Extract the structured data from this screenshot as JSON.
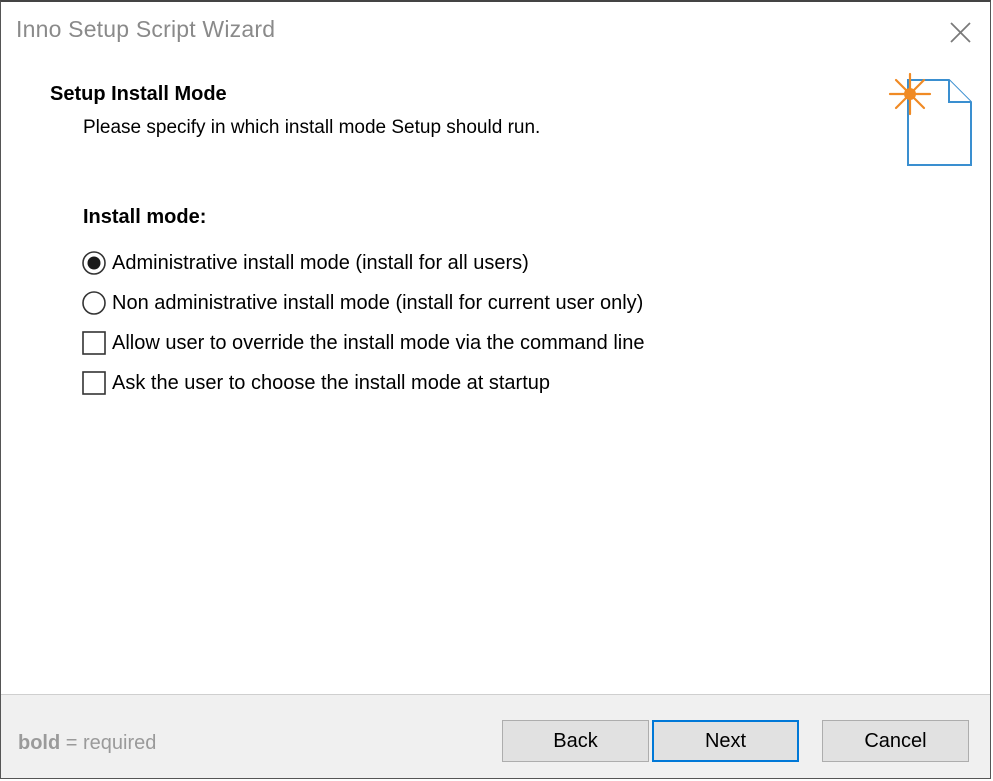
{
  "window": {
    "title": "Inno Setup Script Wizard"
  },
  "page": {
    "heading": "Setup Install Mode",
    "subheading": "Please specify in which install mode Setup should run."
  },
  "install_mode": {
    "label": "Install mode:",
    "options": [
      {
        "type": "radio",
        "label": "Administrative install mode (install for all users)",
        "checked": true
      },
      {
        "type": "radio",
        "label": "Non administrative install mode (install for current user only)",
        "checked": false
      },
      {
        "type": "checkbox",
        "label": "Allow user to override the install mode via the command line",
        "checked": false
      },
      {
        "type": "checkbox",
        "label": "Ask the user to choose the install mode at startup",
        "checked": false
      }
    ]
  },
  "footer": {
    "legend_bold": "bold",
    "legend_rest": " = required",
    "back_label": "Back",
    "next_label": "Next",
    "cancel_label": "Cancel"
  },
  "colors": {
    "accent": "#0078d7",
    "icon_star": "#f08a24",
    "icon_page": "#3a8fd0",
    "footer_bg": "#f0f0f0"
  }
}
